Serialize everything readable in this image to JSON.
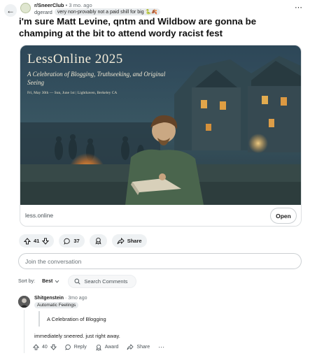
{
  "header": {
    "subreddit": "r/SneerClub",
    "separator": "•",
    "age": "3 mo. ago",
    "username": "dgerard",
    "user_flair": "very non-provably not a paid shill for big 🐍🍂",
    "more_icon": "more-options-icon"
  },
  "post": {
    "title": "i'm sure Matt Levine, qntm and Wildbow are gonna be champing at the bit to attend wordy racist fest"
  },
  "link_card": {
    "banner_title": "LessOnline 2025",
    "banner_subtitle": "A Celebration of Blogging, Truthseeking, and Original Seeing",
    "banner_dates": "Fri, May 30th — Sun, June 1st | Lighthaven, Berkeley CA",
    "domain": "less.online",
    "open_label": "Open"
  },
  "actions": {
    "votes": "41",
    "comments": "37",
    "share_label": "Share"
  },
  "composer": {
    "placeholder": "Join the conversation"
  },
  "sort": {
    "label": "Sort by:",
    "value": "Best",
    "search_placeholder": "Search Comments"
  },
  "comment": {
    "author": "Shitgenstein",
    "age": "3mo ago",
    "flair": "Automatic Feelings",
    "quote": "A Celebration of Blogging",
    "body": "immediately sneered. just right away.",
    "votes": "40",
    "reply_label": "Reply",
    "award_label": "Award",
    "share_label": "Share"
  },
  "colors": {
    "accent": "#1c1c1c",
    "pill_bg": "#eef1f3",
    "border": "#ccd0d3"
  }
}
